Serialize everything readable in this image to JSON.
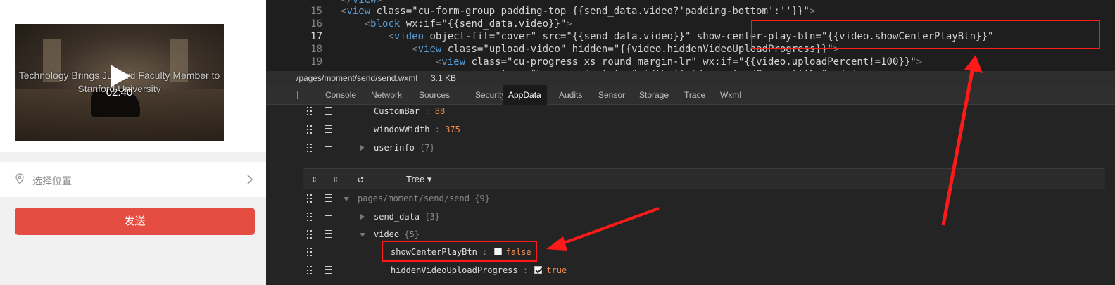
{
  "simulator": {
    "video": {
      "title": "Technology Brings Juilliard Faculty Member to Stanford University",
      "duration": "02:40"
    },
    "location_label": "选择位置",
    "send_label": "发送"
  },
  "editor": {
    "lines": [
      {
        "num": "",
        "text": "</view>"
      },
      {
        "num": "15",
        "text": "<view class=\"cu-form-group padding-top {{send_data.video?'padding-bottom':''}}\">"
      },
      {
        "num": "16",
        "text": "    <block wx:if=\"{{send_data.video}}\">"
      },
      {
        "num": "17",
        "text": "        <video object-fit=\"cover\" src=\"{{send_data.video}}\" show-center-play-btn=\"{{video.showCenterPlayBtn}}\""
      },
      {
        "num": "18",
        "text": "            <view class=\"upload-video\" hidden=\"{{video.hiddenVideoUploadProgress}}\">"
      },
      {
        "num": "19",
        "text": "                <view class=\"cu-progress xs round margin-lr\" wx:if=\"{{video.uploadPercent!=100}}\">"
      },
      {
        "num": "",
        "text": "                    <view class=\"bg-green\" style=\"width:{{video.uploadPercent}}%;\"></view>"
      }
    ]
  },
  "file_bar": {
    "path": "/pages/moment/send/send.wxml",
    "size": "3.1 KB"
  },
  "tabs": [
    "Console",
    "Network",
    "Sources",
    "Security",
    "AppData",
    "Audits",
    "Sensor",
    "Storage",
    "Trace",
    "Wxml"
  ],
  "active_tab": "AppData",
  "global_data": [
    {
      "key": "CustomBar",
      "value": "88"
    },
    {
      "key": "windowWidth",
      "value": "375"
    },
    {
      "key": "userinfo",
      "count": "{7}"
    }
  ],
  "tree": {
    "mode": "Tree",
    "page_path": "pages/moment/send/send",
    "page_count": "{9}",
    "send_data": {
      "key": "send_data",
      "count": "{3}"
    },
    "video": {
      "key": "video",
      "count": "{5}"
    },
    "showCenterPlayBtn": {
      "key": "showCenterPlayBtn",
      "value": "false",
      "checked": false
    },
    "hiddenVideoUploadProgress": {
      "key": "hiddenVideoUploadProgress",
      "value": "true",
      "checked": true
    }
  },
  "colors": {
    "annotation": "#ff1a1a",
    "send_button": "#e54d42",
    "active_tab_bg": "#1a1a1a"
  }
}
